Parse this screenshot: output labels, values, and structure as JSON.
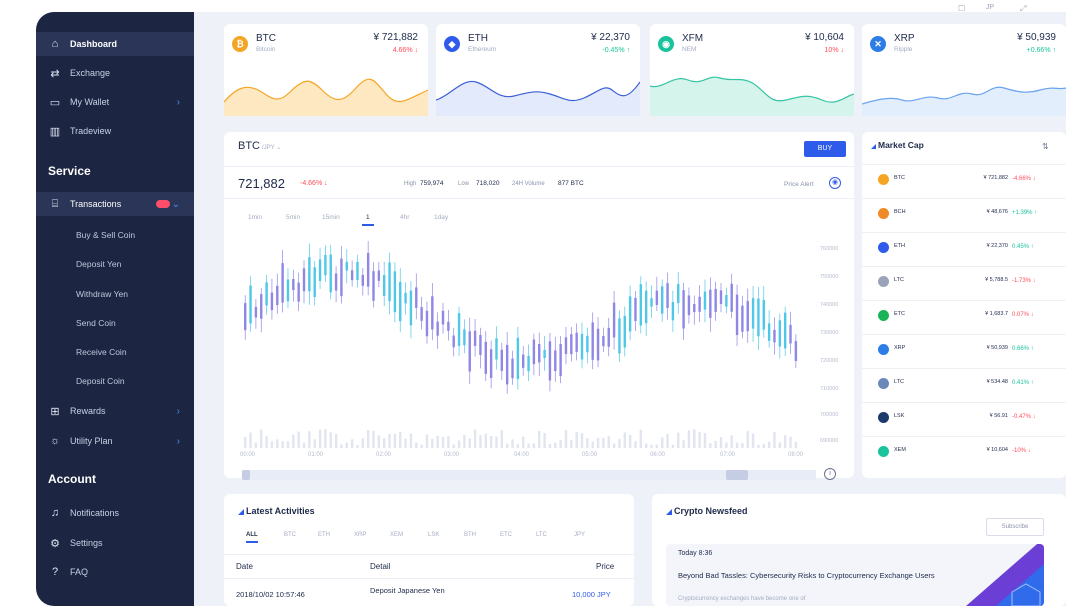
{
  "topbar": {
    "lang": "JP"
  },
  "sidebar": {
    "items": [
      {
        "label": "Dashboard",
        "icon": "home-icon"
      },
      {
        "label": "Exchange",
        "icon": "exchange-icon"
      },
      {
        "label": "My Wallet",
        "icon": "wallet-icon"
      },
      {
        "label": "Tradeview",
        "icon": "chart-icon"
      }
    ],
    "service_title": "Service",
    "transactions": "Transactions",
    "sub_items": [
      "Buy & Sell Coin",
      "Deposit Yen",
      "Withdraw Yen",
      "Send Coin",
      "Receive Coin",
      "Deposit Coin"
    ],
    "rewards": "Rewards",
    "utility": "Utility Plan",
    "account_title": "Account",
    "notifications": "Notifications",
    "settings": "Settings",
    "faq": "FAQ"
  },
  "coins": [
    {
      "sym": "BTC",
      "name": "Bitcoin",
      "price": "¥ 721,882",
      "change": "4.66% ↓",
      "dir": "down",
      "color": "#f5a524",
      "area": "#fde8c2",
      "line": "#f5a524"
    },
    {
      "sym": "ETH",
      "name": "Ethereum",
      "price": "¥ 22,370",
      "change": "-0.45% ↑",
      "dir": "up",
      "color": "#2f5bea",
      "area": "#e3eafc",
      "line": "#3c5fd6"
    },
    {
      "sym": "XFM",
      "name": "NEM",
      "price": "¥ 10,604",
      "change": "10% ↓",
      "dir": "down",
      "color": "#19c39c",
      "area": "#d5f4ec",
      "line": "#36c5a3"
    },
    {
      "sym": "XRP",
      "name": "Ripple",
      "price": "¥ 50,939",
      "change": "+0.66% ↑",
      "dir": "up",
      "color": "#2d7de6",
      "area": "#e3eefc",
      "line": "#6aa3ee"
    }
  ],
  "chart": {
    "pair": "BTC",
    "pair_sub": "/JPY",
    "buy": "BUY",
    "price": "721,882",
    "change": "-4.66% ↓",
    "high_label": "High",
    "high": "759,974",
    "low_label": "Low",
    "low": "718,020",
    "vol_label": "24H Volume",
    "vol": "877 BTC",
    "price_alert": "Price Alert",
    "ranges": [
      "1min",
      "5min",
      "15min",
      "1",
      "4hr",
      "1day"
    ],
    "selected_range": "1",
    "yticks": [
      "760000",
      "750000",
      "740000",
      "730000",
      "720000",
      "710000",
      "700000",
      "690000"
    ],
    "xticks": [
      "00:00",
      "01:00",
      "02:00",
      "03:00",
      "04:00",
      "05:00",
      "06:00",
      "07:00",
      "08:00"
    ]
  },
  "market_cap": {
    "title": "Market Cap",
    "sort_icon": "sort-icon",
    "rows": [
      {
        "sym": "BTC",
        "price": "¥ 721,882",
        "change": "-4.66% ↓",
        "dir": "down",
        "color": "#f5a524"
      },
      {
        "sym": "BCH",
        "price": "¥ 48,676",
        "change": "+1.39% ↑",
        "dir": "up",
        "color": "#f08a24"
      },
      {
        "sym": "ETH",
        "price": "¥ 22,370",
        "change": "0.45% ↑",
        "dir": "up",
        "color": "#2f5bea"
      },
      {
        "sym": "LTC",
        "price": "¥ 5,788.5",
        "change": "-1.73% ↓",
        "dir": "down",
        "color": "#9aa3b8"
      },
      {
        "sym": "ETC",
        "price": "¥ 1,683.7",
        "change": "0.07% ↓",
        "dir": "down",
        "color": "#19b35a"
      },
      {
        "sym": "XRP",
        "price": "¥ 50,939",
        "change": "0.66% ↑",
        "dir": "up",
        "color": "#2d7de6"
      },
      {
        "sym": "LTC",
        "price": "¥ 534.48",
        "change": "0.41% ↑",
        "dir": "up",
        "color": "#6a88b8"
      },
      {
        "sym": "LSK",
        "price": "¥ 56.91",
        "change": "-0.47% ↓",
        "dir": "down",
        "color": "#1c3a6b"
      },
      {
        "sym": "XEM",
        "price": "¥ 10,604",
        "change": "-10% ↓",
        "dir": "down",
        "color": "#19c39c"
      }
    ]
  },
  "activities": {
    "title": "Latest Activities",
    "filters": [
      "ALL",
      "BTC",
      "ETH",
      "XRP",
      "XEM",
      "LSK",
      "BTH",
      "ETC",
      "LTC",
      "JPY"
    ],
    "headers": [
      "Date",
      "Detail",
      "Price"
    ],
    "row": {
      "date": "2018/10/02 10:57:46",
      "detail": "Deposit Japanese Yen",
      "price": "10,000 JPY"
    }
  },
  "news": {
    "title": "Crypto Newsfeed",
    "subscribe": "Subscribe",
    "date": "Today 8:36",
    "headline": "Beyond Bad Tassles: Cybersecurity Risks to Cryptocurrency Exchange Users",
    "body": "Cryptocurrency exchanges have become one of"
  }
}
